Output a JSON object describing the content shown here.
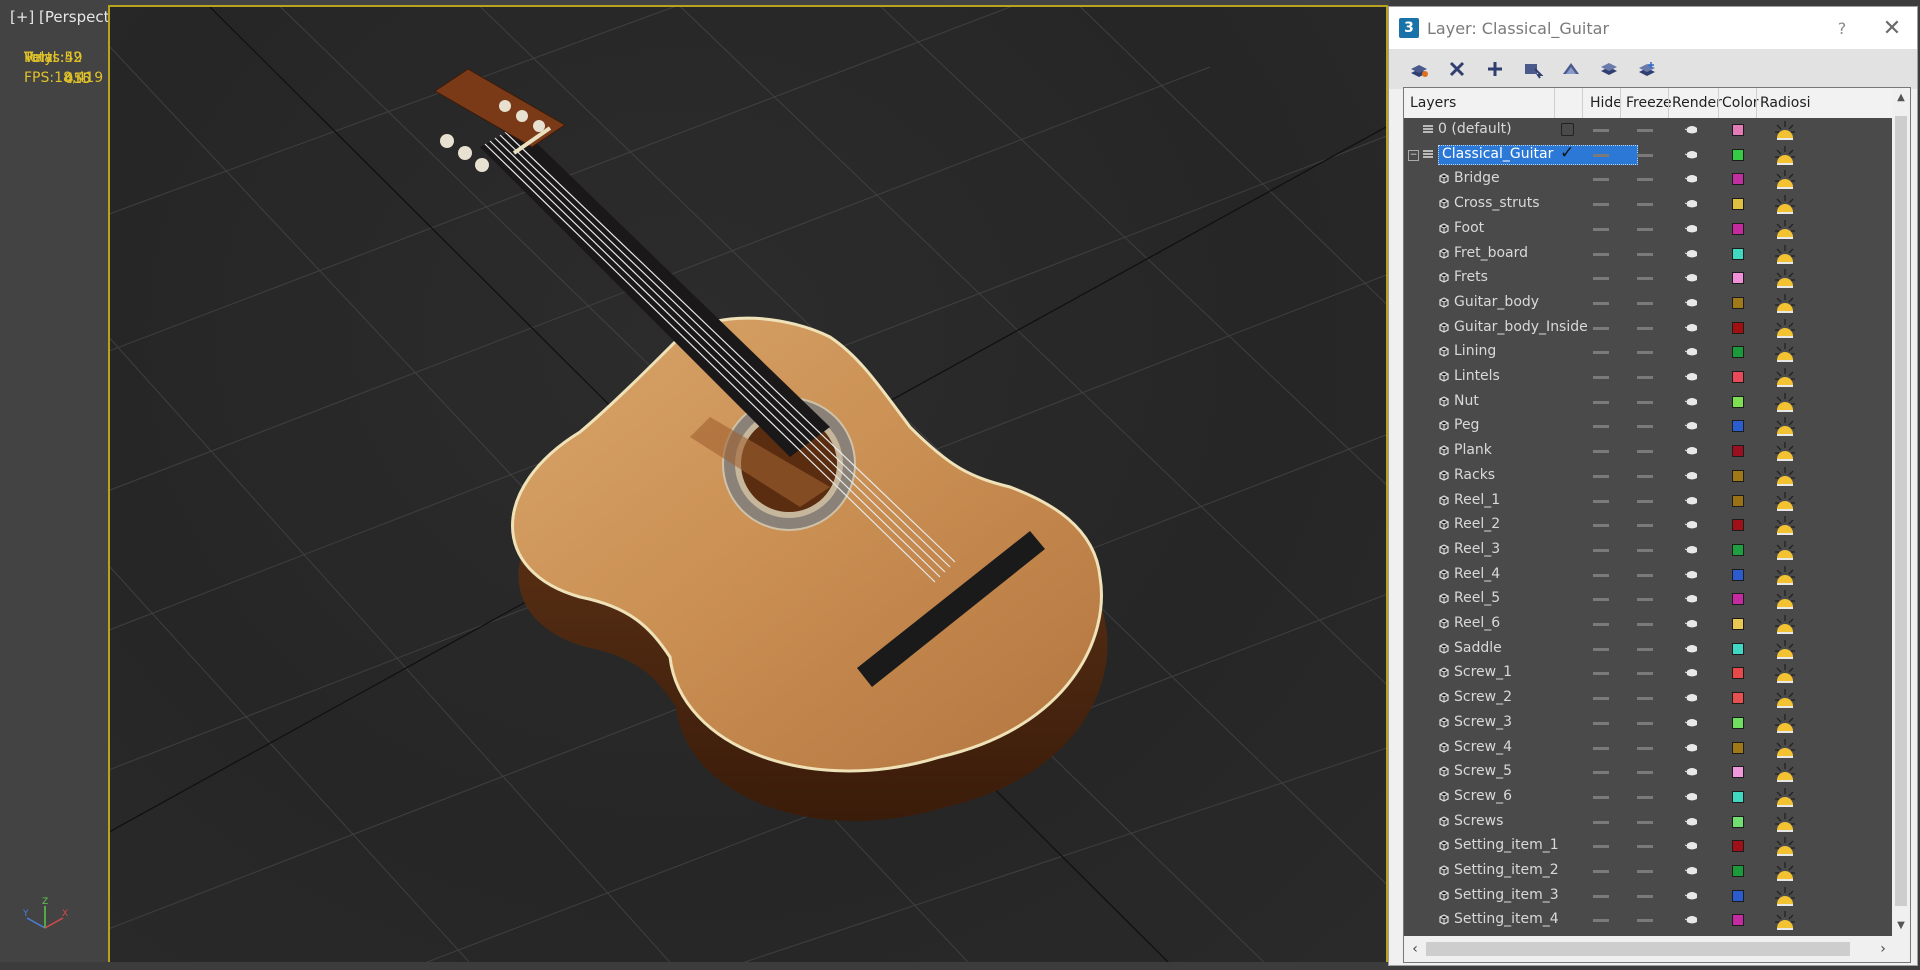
{
  "viewport": {
    "label": "[+] [Perspective ] [Shaded ]",
    "stats": {
      "total_label": "Total",
      "polys_label": "Polys:",
      "polys_value": "49 450",
      "verts_label": "Verts:",
      "verts_value": "52 015",
      "fps_label": "FPS:",
      "fps_value": "18,419"
    }
  },
  "dialog": {
    "title": "Layer: Classical_Guitar",
    "help": "?",
    "close": "✕",
    "toolbar_icons": [
      "create-layer-icon",
      "delete-layer-icon",
      "add-to-layer-icon",
      "select-objects-icon",
      "highlight-layer-icon",
      "hide-all-icon",
      "freeze-all-icon"
    ],
    "columns": [
      "Layers",
      "Hide",
      "Freeze",
      "Render",
      "Color",
      "Radiosi"
    ],
    "rows": [
      {
        "name": "0 (default)",
        "color": "#e47ab6"
      },
      {
        "name": "Classical_Guitar",
        "color": "#33cc44"
      },
      {
        "name": "Bridge",
        "color": "#c02ea0"
      },
      {
        "name": "Cross_struts",
        "color": "#e0c040"
      },
      {
        "name": "Foot",
        "color": "#c42a9e"
      },
      {
        "name": "Fret_board",
        "color": "#3fd8c0"
      },
      {
        "name": "Frets",
        "color": "#f090d8"
      },
      {
        "name": "Guitar_body",
        "color": "#a07a18"
      },
      {
        "name": "Guitar_body_Inside",
        "color": "#a01010"
      },
      {
        "name": "Lining",
        "color": "#1a9a3a"
      },
      {
        "name": "Lintels",
        "color": "#e84a5a"
      },
      {
        "name": "Nut",
        "color": "#7ee050"
      },
      {
        "name": "Peg",
        "color": "#2a5ed0"
      },
      {
        "name": "Plank",
        "color": "#9a1020"
      },
      {
        "name": "Racks",
        "color": "#a07818"
      },
      {
        "name": "Reel_1",
        "color": "#9a7214"
      },
      {
        "name": "Reel_2",
        "color": "#a01018"
      },
      {
        "name": "Reel_3",
        "color": "#1ea040"
      },
      {
        "name": "Reel_4",
        "color": "#2a5cd0"
      },
      {
        "name": "Reel_5",
        "color": "#c62aa2"
      },
      {
        "name": "Reel_6",
        "color": "#e8c850"
      },
      {
        "name": "Saddle",
        "color": "#3ed8c4"
      },
      {
        "name": "Screw_1",
        "color": "#e84848"
      },
      {
        "name": "Screw_2",
        "color": "#e85050"
      },
      {
        "name": "Screw_3",
        "color": "#70e060"
      },
      {
        "name": "Screw_4",
        "color": "#a07818"
      },
      {
        "name": "Screw_5",
        "color": "#f098dc"
      },
      {
        "name": "Screw_6",
        "color": "#40d8c0"
      },
      {
        "name": "Screws",
        "color": "#70e070"
      },
      {
        "name": "Setting_item_1",
        "color": "#a01018"
      },
      {
        "name": "Setting_item_2",
        "color": "#1a9a38"
      },
      {
        "name": "Setting_item_3",
        "color": "#2a5cd0"
      },
      {
        "name": "Setting_item_4",
        "color": "#c62aa2"
      }
    ]
  }
}
